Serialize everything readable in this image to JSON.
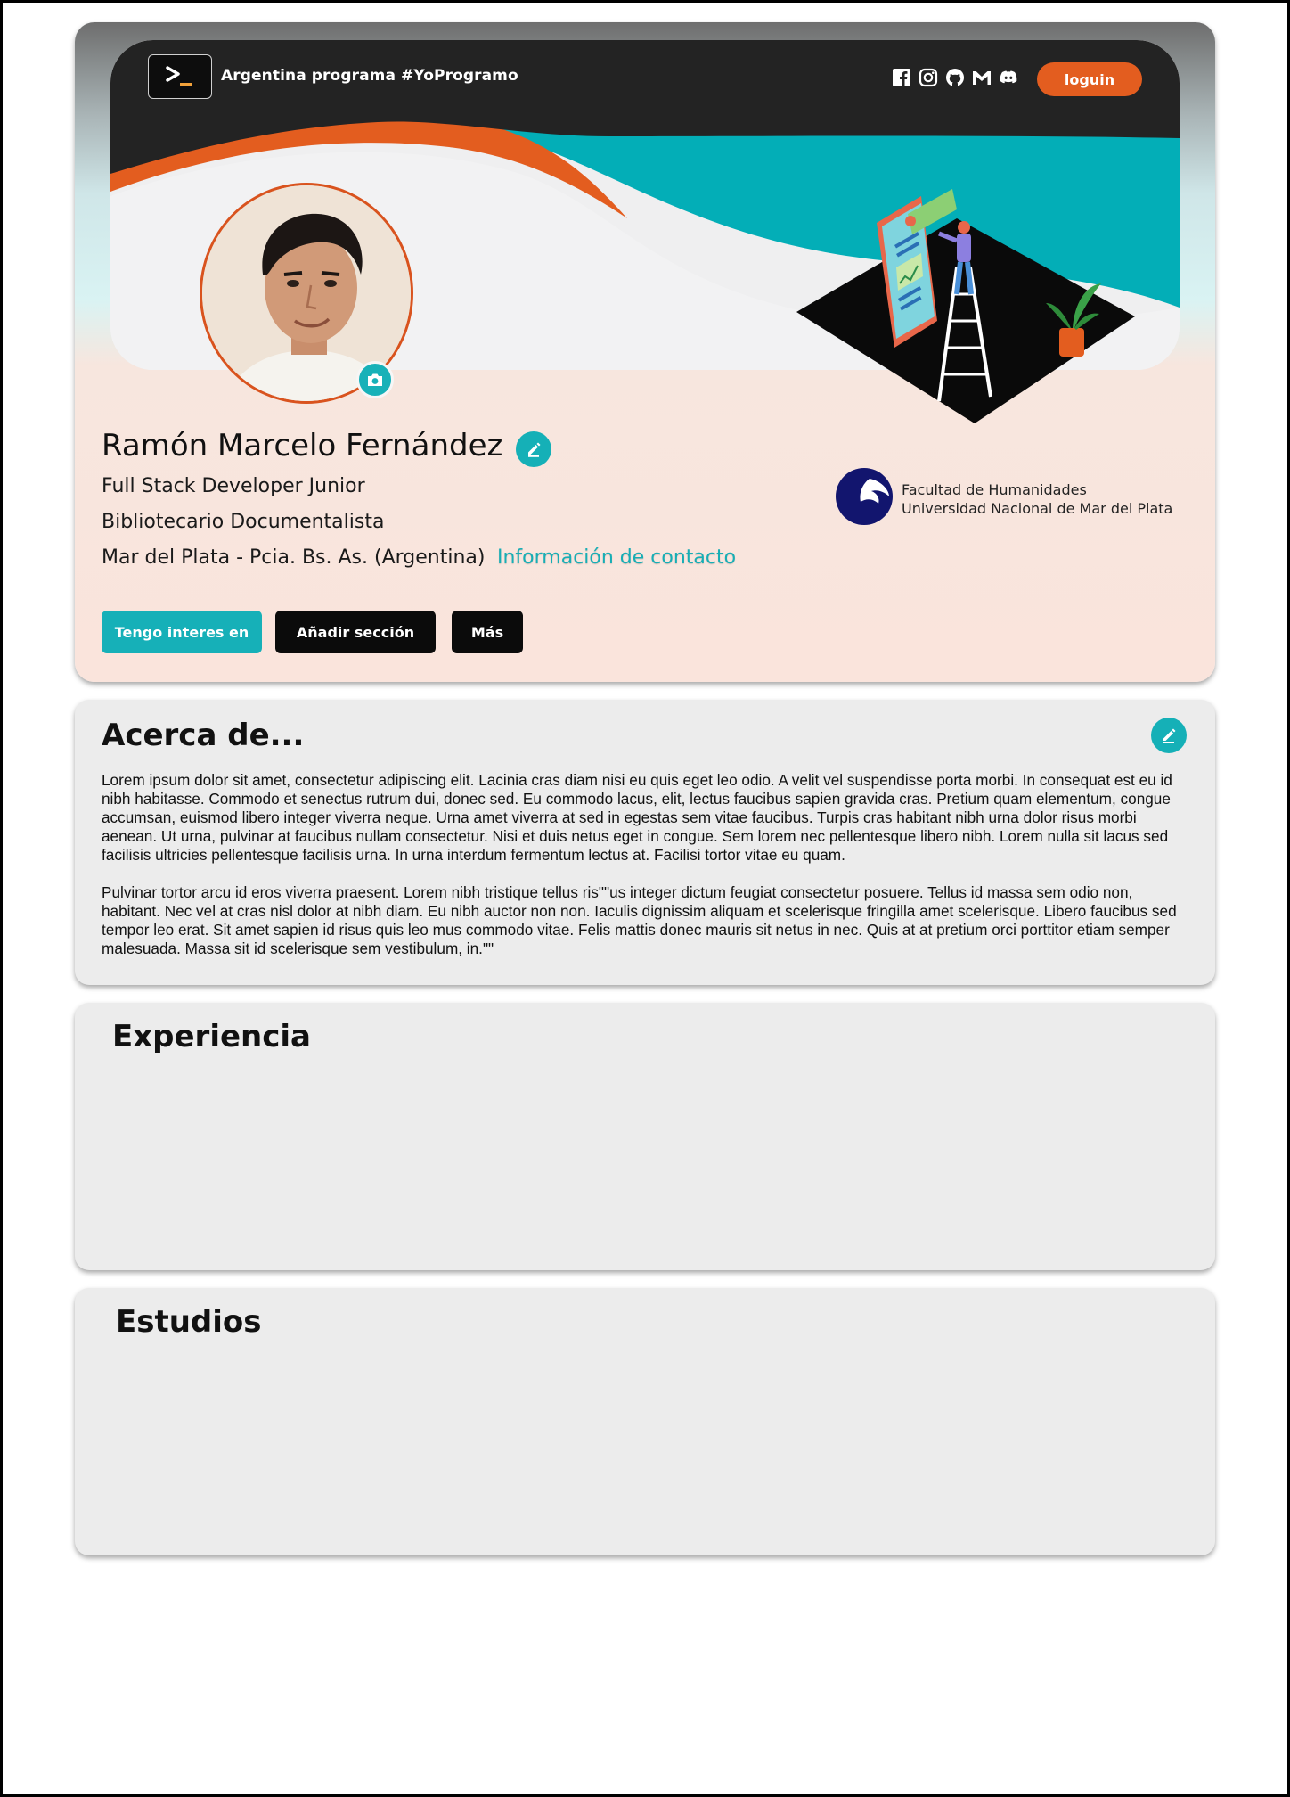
{
  "header": {
    "brand": "Argentina programa  #YoProgramo",
    "login_label": "loguin",
    "social_icons": [
      "facebook-icon",
      "instagram-icon",
      "github-icon",
      "gmail-icon",
      "discord-icon"
    ]
  },
  "profile": {
    "name": "Ramón Marcelo Fernández",
    "title_1": "Full Stack Developer Junior",
    "title_2": "Bibliotecario Documentalista",
    "location": "Mar del Plata - Pcia. Bs. As.  (Argentina)",
    "contact_link": "Información de contacto",
    "institution_line_1": "Facultad de Humanidades",
    "institution_line_2": "Universidad Nacional de Mar del Plata"
  },
  "actions": {
    "interest": "Tengo interes en",
    "add_section": "Añadir sección",
    "more": "Más"
  },
  "about": {
    "title": "Acerca de...",
    "paragraph_1": "Lorem ipsum dolor sit amet, consectetur adipiscing elit. Lacinia cras diam nisi eu quis eget leo odio. A velit vel suspendisse porta morbi. In consequat est eu id nibh habitasse. Commodo et senectus rutrum dui, donec sed. Eu commodo lacus, elit, lectus faucibus sapien gravida cras. Pretium quam elementum, congue accumsan, euismod libero integer viverra neque. Urna amet viverra at sed in egestas sem vitae faucibus. Turpis cras habitant nibh urna dolor risus morbi aenean. Ut urna, pulvinar at faucibus nullam consectetur. Nisi et duis netus eget in congue. Sem lorem nec pellentesque libero nibh. Lorem nulla sit lacus sed facilisis ultricies pellentesque facilisis urna. In urna interdum fermentum lectus at. Facilisi tortor vitae eu quam.",
    "paragraph_2": "Pulvinar tortor arcu id eros viverra praesent. Lorem nibh tristique tellus ris\"\"us integer dictum feugiat consectetur posuere. Tellus id massa sem odio non, habitant. Nec vel at cras nisl dolor at nibh diam. Eu nibh auctor non non. Iaculis dignissim aliquam et scelerisque fringilla amet scelerisque. Libero faucibus sed tempor leo erat. Sit amet sapien id risus quis leo mus commodo vitae. Felis mattis donec mauris sit netus in nec. Quis at at pretium orci porttitor etiam semper malesuada. Massa sit id scelerisque sem vestibulum, in.\"\""
  },
  "experience": {
    "title": "Experiencia"
  },
  "education": {
    "title": "Estudios"
  },
  "colors": {
    "accent_teal": "#15b0b7",
    "accent_orange": "#e35d1f",
    "dark": "#0b0b0b",
    "card_bg": "#ececec"
  }
}
